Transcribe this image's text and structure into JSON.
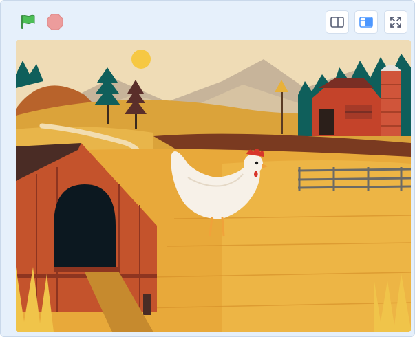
{
  "toolbar": {
    "green_flag": {
      "icon": "green-flag-icon",
      "color": "#4cbf56"
    },
    "stop": {
      "icon": "stop-icon",
      "color": "#ec9c9c"
    },
    "stage_modes": [
      {
        "icon": "small-stage-icon",
        "selected": false
      },
      {
        "icon": "large-stage-icon",
        "selected": true
      },
      {
        "icon": "fullscreen-icon",
        "selected": false
      }
    ],
    "accent": "#4c97ff"
  },
  "stage": {
    "backdrop": "farm",
    "sprite": "hen",
    "colors": {
      "sky": "#efdcb6",
      "sun": "#f6c843",
      "mountains": "#c7b49a",
      "field": "#e8b13a",
      "barn": "#c4432a",
      "silo": "#d0553a",
      "trees": "#0f5f5b"
    }
  }
}
